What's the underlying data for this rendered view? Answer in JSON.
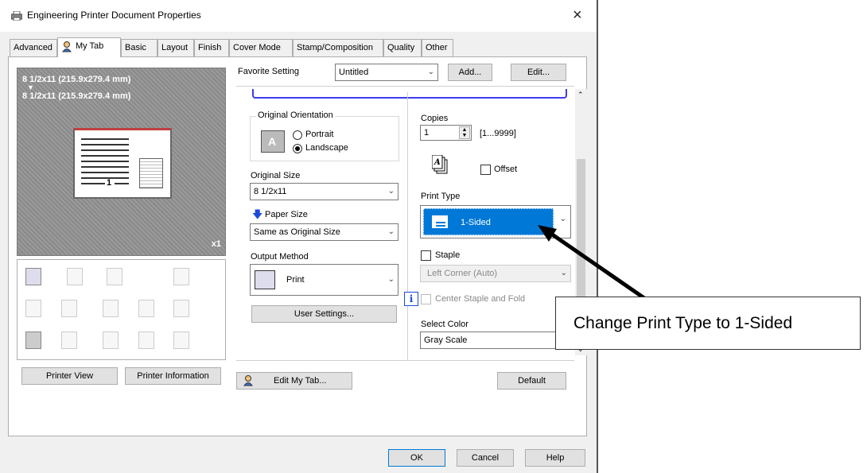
{
  "window": {
    "title": "Engineering Printer Document Properties",
    "close": "×"
  },
  "tabs": [
    "Advanced",
    "My Tab",
    "Basic",
    "Layout",
    "Finish",
    "Cover Mode",
    "Stamp/Composition",
    "Quality",
    "Other"
  ],
  "preview": {
    "size_line1": "8 1/2x11 (215.9x279.4 mm)",
    "arrow": "▼",
    "size_line2": "8 1/2x11 (215.9x279.4 mm)",
    "page_number": "1",
    "copies_badge": "x1"
  },
  "left_buttons": {
    "printer_view": "Printer View",
    "printer_info": "Printer Information"
  },
  "favorite": {
    "label": "Favorite Setting",
    "value": "Untitled",
    "add": "Add...",
    "edit": "Edit..."
  },
  "orientation": {
    "group": "Original Orientation",
    "icon_letter": "A",
    "portrait": "Portrait",
    "landscape": "Landscape",
    "selected": "Landscape"
  },
  "original_size": {
    "label": "Original Size",
    "value": "8 1/2x11"
  },
  "paper_size": {
    "label": "Paper Size",
    "value": "Same as Original Size"
  },
  "output_method": {
    "label": "Output Method",
    "value": "Print"
  },
  "user_settings": "User Settings...",
  "copies": {
    "label": "Copies",
    "value": "1",
    "range": "[1...9999]"
  },
  "offset": "Offset",
  "print_type": {
    "label": "Print Type",
    "value": "1-Sided"
  },
  "staple": {
    "label": "Staple",
    "value": "Left Corner (Auto)"
  },
  "center_staple": "Center Staple and Fold",
  "info_icon": "i",
  "select_color": {
    "label": "Select Color",
    "value": "Gray Scale"
  },
  "edit_my_tab": "Edit My Tab...",
  "default_btn": "Default",
  "footer": {
    "ok": "OK",
    "cancel": "Cancel",
    "help": "Help"
  },
  "callout": "Change Print Type to 1-Sided",
  "colors": {
    "accent": "#0078d7",
    "callout_arrow": "#000000"
  }
}
